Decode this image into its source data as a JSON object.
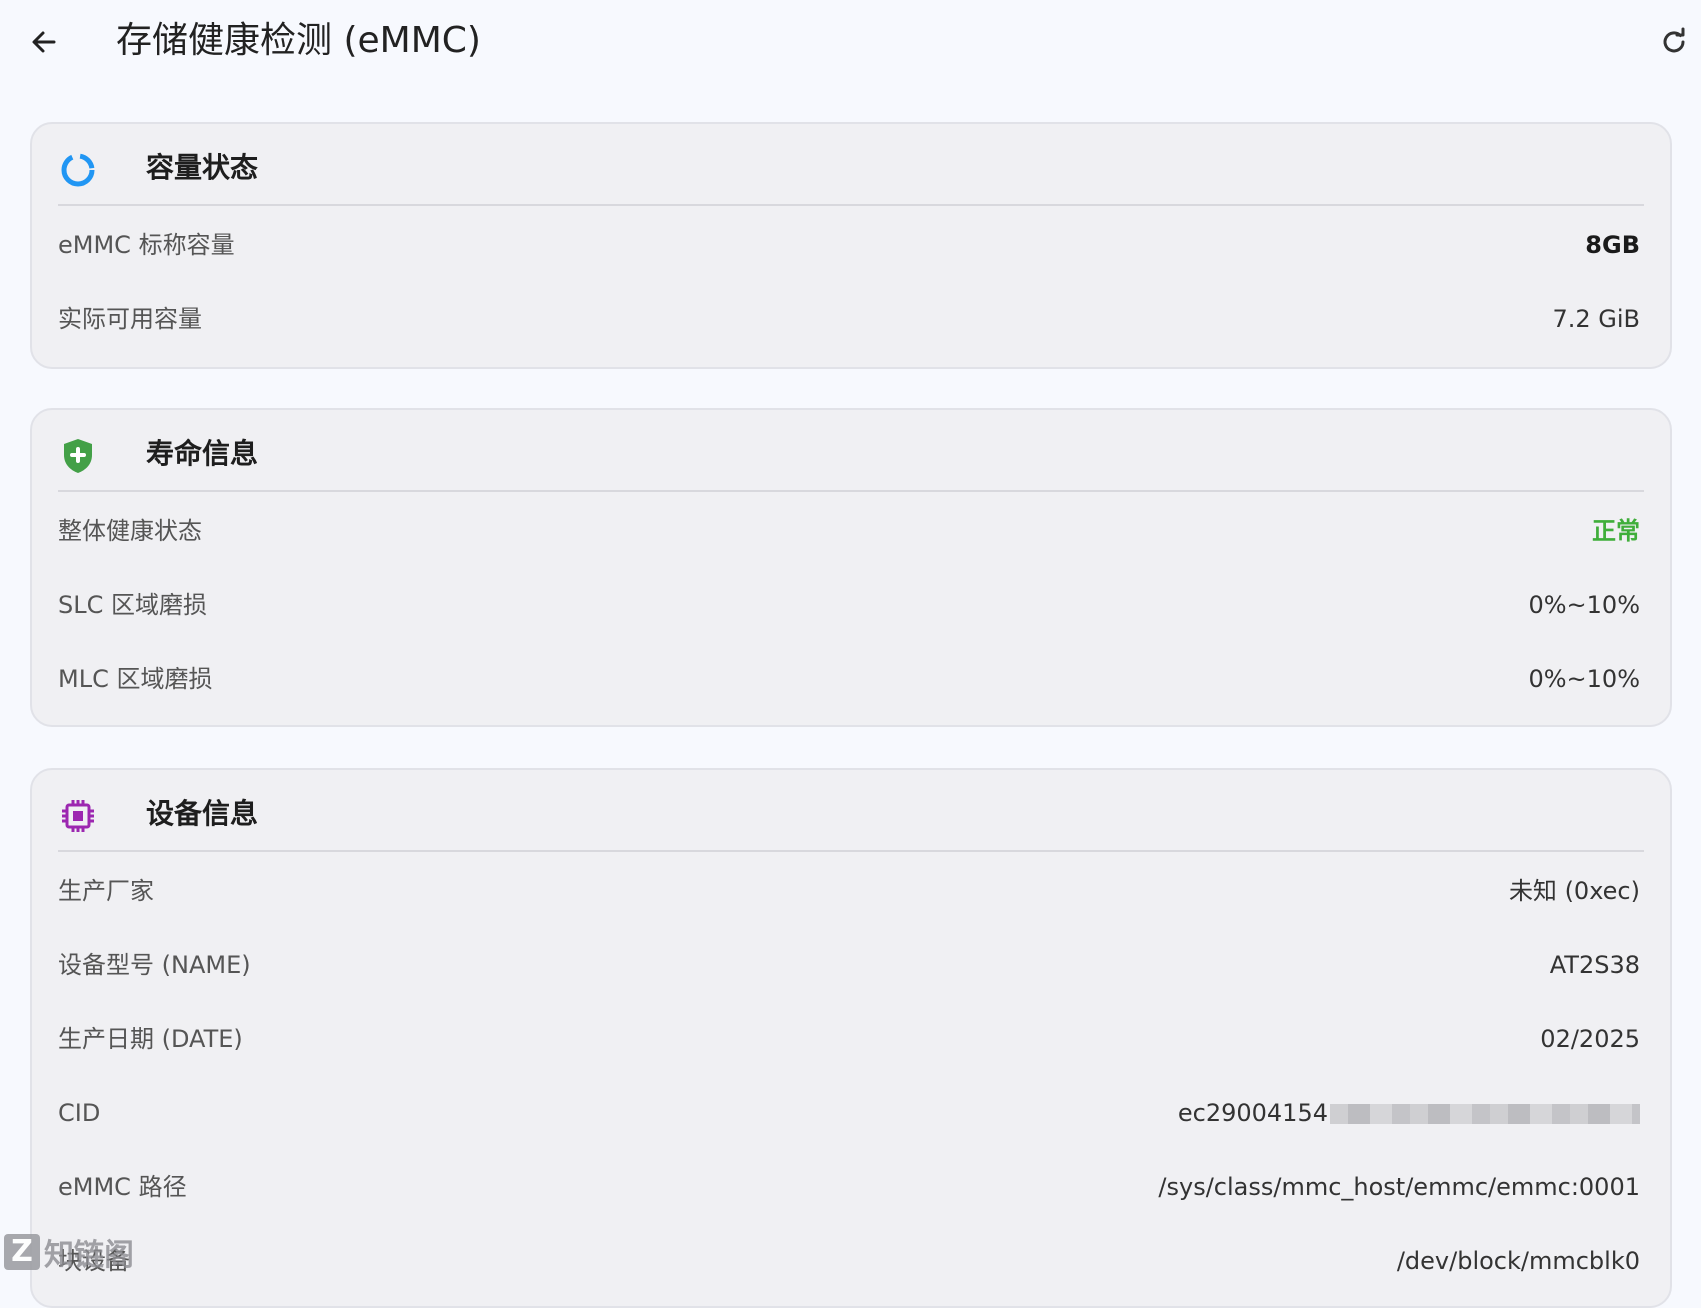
{
  "header": {
    "title": "存储健康检测 (eMMC)",
    "back_icon": "arrow-left-icon",
    "refresh_icon": "refresh-icon"
  },
  "capacity": {
    "title": "容量状态",
    "icon": "ring-progress-icon",
    "icon_color": "#2196f3",
    "rows": [
      {
        "label": "eMMC 标称容量",
        "value": "8GB"
      },
      {
        "label": "实际可用容量",
        "value": "7.2 GiB"
      }
    ]
  },
  "lifetime": {
    "title": "寿命信息",
    "icon": "shield-plus-icon",
    "icon_color": "#43a047",
    "rows": [
      {
        "label": "整体健康状态",
        "value": "正常",
        "value_color": "#3fae3a"
      },
      {
        "label": "SLC 区域磨损",
        "value": "0%~10%"
      },
      {
        "label": "MLC 区域磨损",
        "value": "0%~10%"
      }
    ]
  },
  "device": {
    "title": "设备信息",
    "icon": "chip-icon",
    "icon_color": "#9c27b0",
    "rows": [
      {
        "label": "生产厂家",
        "value": "未知 (0xec)"
      },
      {
        "label": "设备型号 (NAME)",
        "value": "AT2S38"
      },
      {
        "label": "生产日期 (DATE)",
        "value": "02/2025"
      },
      {
        "label": "CID",
        "value": "ec29004154"
      },
      {
        "label": "eMMC 路径",
        "value": "/sys/class/mmc_host/emmc/emmc:0001"
      },
      {
        "label": "块设备",
        "value": "/dev/block/mmcblk0"
      }
    ]
  },
  "watermark": {
    "logo_letter": "Z",
    "text": "知链阁"
  }
}
